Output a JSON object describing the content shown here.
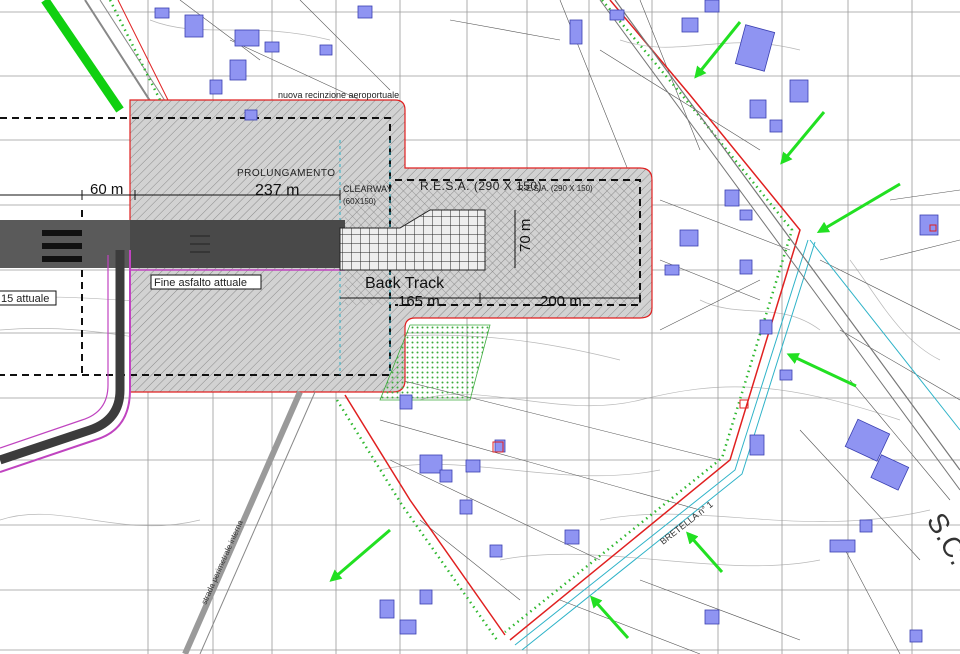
{
  "labels": {
    "nuova_recinzione": "nuova recinzione aeroportuale",
    "prolungamento": "PROLUNGAMENTO",
    "dim_237": "237 m",
    "clearway": "CLEARWAY",
    "clearway_size": "(60X150)",
    "resa_left": "R.E.S.A. (290 X 150)",
    "resa_right": "R.E.S.A. (290 X 150)",
    "dim_60": "60 m",
    "dim_70": "70 m",
    "fine_asfalto": "Fine asfalto attuale",
    "attuale_15": "15 attuale",
    "back_track": "Back Track",
    "dim_165": "165 m",
    "dim_200": "200 m",
    "strada_perimetrale": "strada perimetrale interna",
    "bretella": "BRETELLA n° 1",
    "sc": "S.C."
  },
  "colors": {
    "grid": "#9a9a9a",
    "building": "#8f94f2",
    "building_edge": "#3a3fb0",
    "fence_red": "#e02020",
    "fence_green_dot": "#2fb82f",
    "arrow_green": "#22e022",
    "hatch_gray": "#bdbdbd",
    "runway_dark": "#3c3c3c",
    "magenta": "#c044c0",
    "cyan": "#2fb3c8",
    "green_hatch": "#4caf50"
  },
  "arrows": [
    "green-arrow",
    "green-arrow",
    "green-arrow",
    "green-arrow",
    "green-arrow",
    "green-arrow",
    "green-arrow"
  ]
}
